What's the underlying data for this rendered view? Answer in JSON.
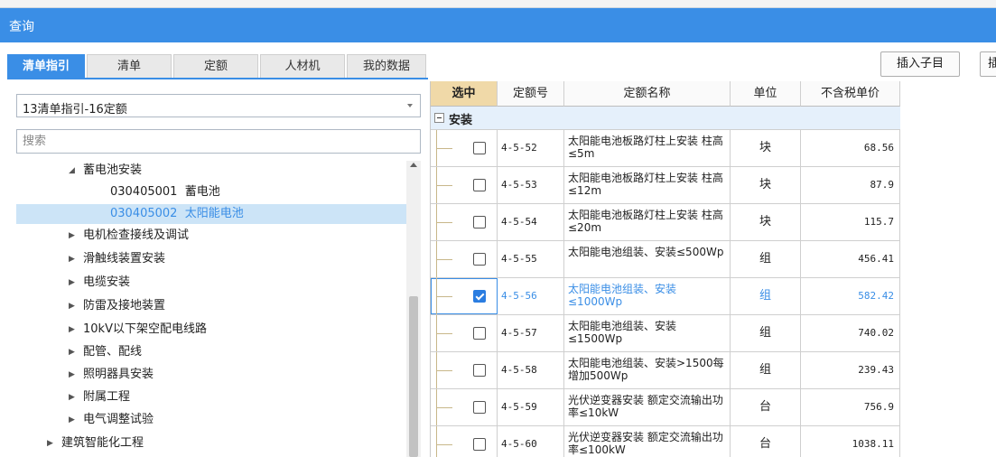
{
  "window": {
    "title": "查询"
  },
  "tabs": [
    {
      "label": "清单指引",
      "active": true
    },
    {
      "label": "清单",
      "active": false
    },
    {
      "label": "定额",
      "active": false
    },
    {
      "label": "人材机",
      "active": false
    },
    {
      "label": "我的数据",
      "active": false
    }
  ],
  "toolbar": {
    "insert_child_label": "插入子目",
    "insert_label": "插"
  },
  "library": {
    "selected": "13清单指引-16定额"
  },
  "search": {
    "placeholder": "搜索",
    "value": ""
  },
  "tree": [
    {
      "label": "蓄电池安装",
      "expander": "expanded"
    },
    {
      "label": "030405001  蓄电池",
      "expander": "none"
    },
    {
      "label": "030405002  太阳能电池",
      "expander": "none",
      "selected": true
    },
    {
      "label": "电机检查接线及调试",
      "expander": "collapsed"
    },
    {
      "label": "滑触线装置安装",
      "expander": "collapsed"
    },
    {
      "label": "电缆安装",
      "expander": "collapsed"
    },
    {
      "label": "防雷及接地装置",
      "expander": "collapsed"
    },
    {
      "label": "10kV以下架空配电线路",
      "expander": "collapsed"
    },
    {
      "label": "配管、配线",
      "expander": "collapsed"
    },
    {
      "label": "照明器具安装",
      "expander": "collapsed"
    },
    {
      "label": "附属工程",
      "expander": "collapsed"
    },
    {
      "label": "电气调整试验",
      "expander": "collapsed"
    },
    {
      "label": "建筑智能化工程",
      "expander": "collapsed"
    }
  ],
  "grid": {
    "headers": [
      "选中",
      "定额号",
      "定额名称",
      "单位",
      "不含税单价"
    ],
    "group_label": "安装",
    "rows": [
      {
        "code": "4-5-52",
        "name": "太阳能电池板路灯柱上安装 柱高≤5m",
        "unit": "块",
        "price": "68.56",
        "checked": false
      },
      {
        "code": "4-5-53",
        "name": "太阳能电池板路灯柱上安装 柱高≤12m",
        "unit": "块",
        "price": "87.9",
        "checked": false
      },
      {
        "code": "4-5-54",
        "name": "太阳能电池板路灯柱上安装 柱高≤20m",
        "unit": "块",
        "price": "115.7",
        "checked": false
      },
      {
        "code": "4-5-55",
        "name": "太阳能电池组装、安装≤500Wp",
        "unit": "组",
        "price": "456.41",
        "checked": false
      },
      {
        "code": "4-5-56",
        "name": "太阳能电池组装、安装≤1000Wp",
        "unit": "组",
        "price": "582.42",
        "checked": true
      },
      {
        "code": "4-5-57",
        "name": "太阳能电池组装、安装≤1500Wp",
        "unit": "组",
        "price": "740.02",
        "checked": false
      },
      {
        "code": "4-5-58",
        "name": "太阳能电池组装、安装>1500每增加500Wp",
        "unit": "组",
        "price": "239.43",
        "checked": false
      },
      {
        "code": "4-5-59",
        "name": "光伏逆变器安装 额定交流输出功率≤10kW",
        "unit": "台",
        "price": "756.9",
        "checked": false
      },
      {
        "code": "4-5-60",
        "name": "光伏逆变器安装 额定交流输出功率≤100kW",
        "unit": "台",
        "price": "1038.11",
        "checked": false
      }
    ]
  },
  "colors": {
    "accent": "#3a8ee6",
    "header_selected": "#f0d9a8",
    "tree_selected": "#cce4f7"
  }
}
